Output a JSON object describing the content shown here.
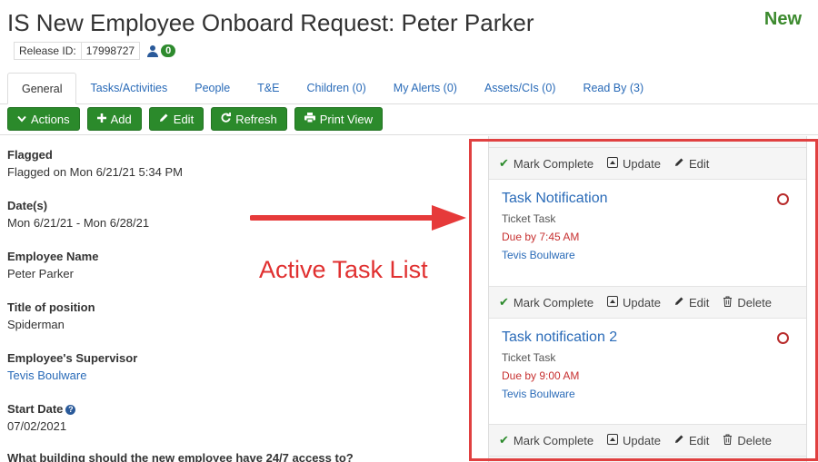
{
  "header": {
    "title": "IS New Employee Onboard Request: Peter Parker",
    "status": "New",
    "release_label": "Release ID:",
    "release_id": "17998727",
    "people_count": "0"
  },
  "tabs": [
    {
      "label": "General",
      "active": true
    },
    {
      "label": "Tasks/Activities"
    },
    {
      "label": "People"
    },
    {
      "label": "T&E"
    },
    {
      "label": "Children (0)"
    },
    {
      "label": "My Alerts (0)"
    },
    {
      "label": "Assets/CIs (0)"
    },
    {
      "label": "Read By (3)"
    }
  ],
  "toolbar": {
    "actions": "Actions",
    "add": "Add",
    "edit": "Edit",
    "refresh": "Refresh",
    "print": "Print View"
  },
  "fields": [
    {
      "label": "Flagged",
      "value": "Flagged on Mon 6/21/21 5:34 PM"
    },
    {
      "label": "Date(s)",
      "value": "Mon 6/21/21 - Mon 6/28/21"
    },
    {
      "label": "Employee Name",
      "value": "Peter Parker"
    },
    {
      "label": "Title of position",
      "value": "Spiderman"
    },
    {
      "label": "Employee's Supervisor",
      "value": "Tevis Boulware"
    },
    {
      "label": "Start Date",
      "value": "07/02/2021"
    }
  ],
  "question": "What building should the new employee have 24/7 access to?",
  "annotation": "Active Task List",
  "task_actions": {
    "mark_complete": "Mark Complete",
    "update": "Update",
    "edit": "Edit",
    "delete": "Delete"
  },
  "tasks": [
    {
      "name": "Task Notification",
      "type": "Ticket Task",
      "due": "Due by 7:45 AM",
      "assigned": "Tevis Boulware"
    },
    {
      "name": "Task notification 2",
      "type": "Ticket Task",
      "due": "Due by 9:00 AM",
      "assigned": "Tevis Boulware"
    }
  ],
  "colors": {
    "accent_green": "#2b8a2b",
    "link_blue": "#2a6bb8",
    "annotation_red": "#e03030"
  }
}
